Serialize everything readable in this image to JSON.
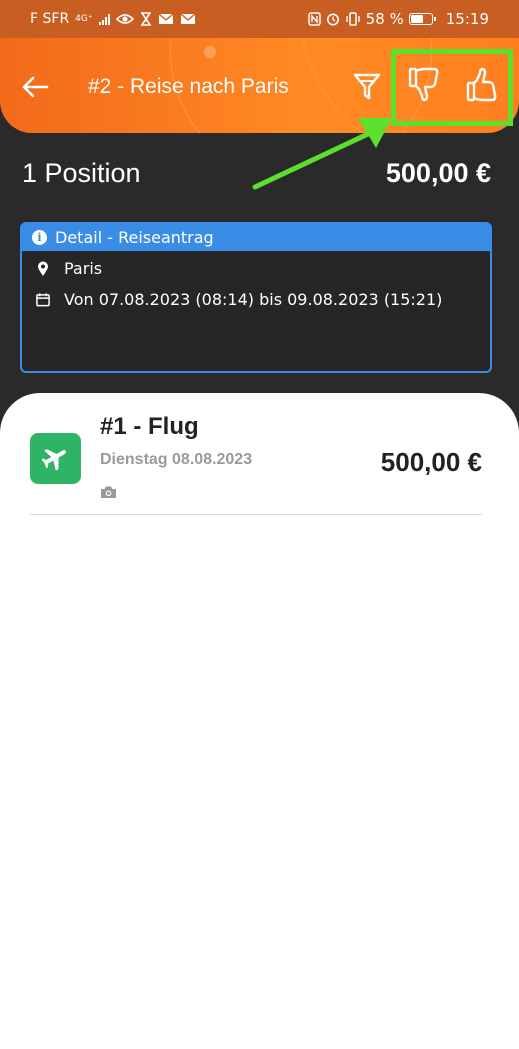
{
  "status_bar": {
    "carrier": "F SFR",
    "network": "4G⁺",
    "battery": "58 %",
    "time": "15:19"
  },
  "header": {
    "title": "#2 - Reise nach Paris"
  },
  "summary": {
    "positions": "1 Position",
    "total": "500,00 €"
  },
  "detail": {
    "header": "Detail - Reiseantrag",
    "location": "Paris",
    "period": "Von 07.08.2023 (08:14) bis 09.08.2023 (15:21)"
  },
  "items": [
    {
      "title": "#1 - Flug",
      "date": "Dienstag 08.08.2023",
      "amount": "500,00 €"
    }
  ],
  "colors": {
    "accent": "#ff7f1f",
    "highlight": "#5ce02e",
    "info_blue": "#3a8de6",
    "flight_green": "#2fb465"
  }
}
